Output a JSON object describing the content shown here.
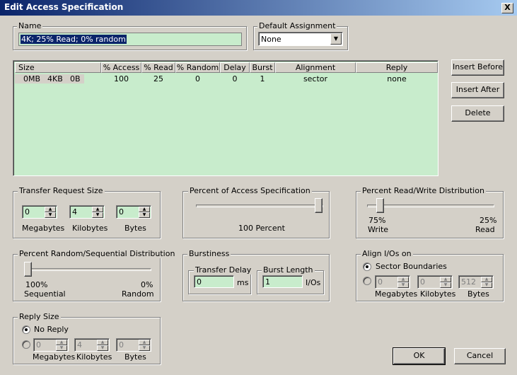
{
  "window": {
    "title": "Edit Access Specification",
    "close_label": "X"
  },
  "name_group": {
    "label": "Name",
    "value": "4K; 25% Read; 0% random"
  },
  "default_assignment": {
    "label": "Default Assignment",
    "value": "None"
  },
  "list": {
    "columns": [
      "Size",
      "% Access",
      "% Read",
      "% Random",
      "Delay",
      "Burst",
      "Alignment",
      "Reply"
    ],
    "rows": [
      {
        "size_mb": "0MB",
        "size_kb": "4KB",
        "size_b": "0B",
        "access": "100",
        "read": "25",
        "random": "0",
        "delay": "0",
        "burst": "1",
        "alignment": "sector",
        "reply": "none"
      }
    ]
  },
  "buttons": {
    "insert_before": "Insert Before",
    "insert_after": "Insert After",
    "delete": "Delete",
    "ok": "OK",
    "cancel": "Cancel"
  },
  "transfer": {
    "label": "Transfer Request Size",
    "mb": "0",
    "kb": "4",
    "b": "0",
    "mb_label": "Megabytes",
    "kb_label": "Kilobytes",
    "b_label": "Bytes"
  },
  "percent_access": {
    "label": "Percent of Access Specification",
    "value_text": "100 Percent",
    "value": 100
  },
  "read_write": {
    "label": "Percent Read/Write Distribution",
    "left_pct": "75%",
    "left_label": "Write",
    "right_pct": "25%",
    "right_label": "Read",
    "read_percent": 25
  },
  "random_seq": {
    "label": "Percent Random/Sequential Distribution",
    "left_pct": "100%",
    "left_label": "Sequential",
    "right_pct": "0%",
    "right_label": "Random",
    "random_percent": 0
  },
  "burstiness": {
    "label": "Burstiness",
    "delay_label": "Transfer Delay",
    "delay_value": "0",
    "delay_unit": "ms",
    "burst_label": "Burst Length",
    "burst_value": "1",
    "burst_unit": "I/Os"
  },
  "align": {
    "label": "Align I/Os on",
    "sector_label": "Sector Boundaries",
    "mb": "0",
    "kb": "0",
    "b": "512",
    "mb_label": "Megabytes",
    "kb_label": "Kilobytes",
    "b_label": "Bytes"
  },
  "reply": {
    "label": "Reply Size",
    "no_reply_label": "No Reply",
    "mb": "0",
    "kb": "4",
    "b": "0",
    "mb_label": "Megabytes",
    "kb_label": "Kilobytes",
    "b_label": "Bytes"
  }
}
